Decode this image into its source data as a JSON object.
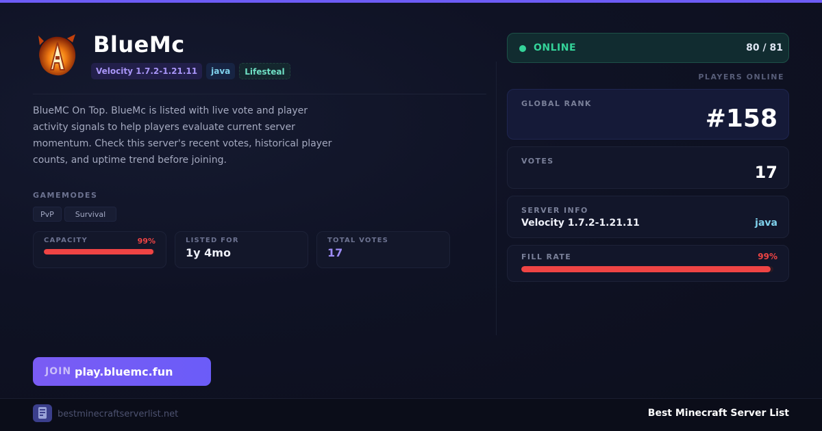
{
  "server": {
    "name": "BlueMc",
    "logo_icon": "dragon-letter-a-icon",
    "tags": {
      "version": "Velocity 1.7.2-1.21.11",
      "edition": "java",
      "mode": "Lifesteal"
    },
    "description": "BlueMC On Top. BlueMc is listed with live vote and player activity signals to help players evaluate current server momentum. Check this server's recent votes, historical player counts, and uptime trend before joining."
  },
  "gamemodes": {
    "label": "GAMEMODES",
    "items": [
      "PvP",
      "Survival"
    ]
  },
  "stats": {
    "capacity": {
      "label": "CAPACITY",
      "percent_text": "99%",
      "fill": 0.99
    },
    "listed_for": {
      "label": "LISTED FOR",
      "value": "1y 4mo"
    },
    "total_votes": {
      "label": "TOTAL VOTES",
      "value": "17"
    }
  },
  "join": {
    "label": "JOIN",
    "address": "play.bluemc.fun"
  },
  "status": {
    "state": "ONLINE",
    "players": "80 / 81",
    "players_label": "PLAYERS ONLINE",
    "color": "#34d399"
  },
  "panels": {
    "rank": {
      "label": "GLOBAL RANK",
      "value": "#158"
    },
    "votes": {
      "label": "VOTES",
      "value": "17"
    },
    "info": {
      "label": "SERVER INFO",
      "version": "Velocity 1.7.2-1.21.11",
      "edition": "java"
    },
    "fill": {
      "label": "FILL RATE",
      "percent_text": "99%",
      "fill": 0.99
    }
  },
  "footer": {
    "site_icon": "server-list-logo-icon",
    "site": "bestminecraftserverlist.net",
    "brand": "Best Minecraft Server List"
  },
  "colors": {
    "accent": "#6d5cf6",
    "online": "#34d399",
    "danger": "#ef4444"
  }
}
